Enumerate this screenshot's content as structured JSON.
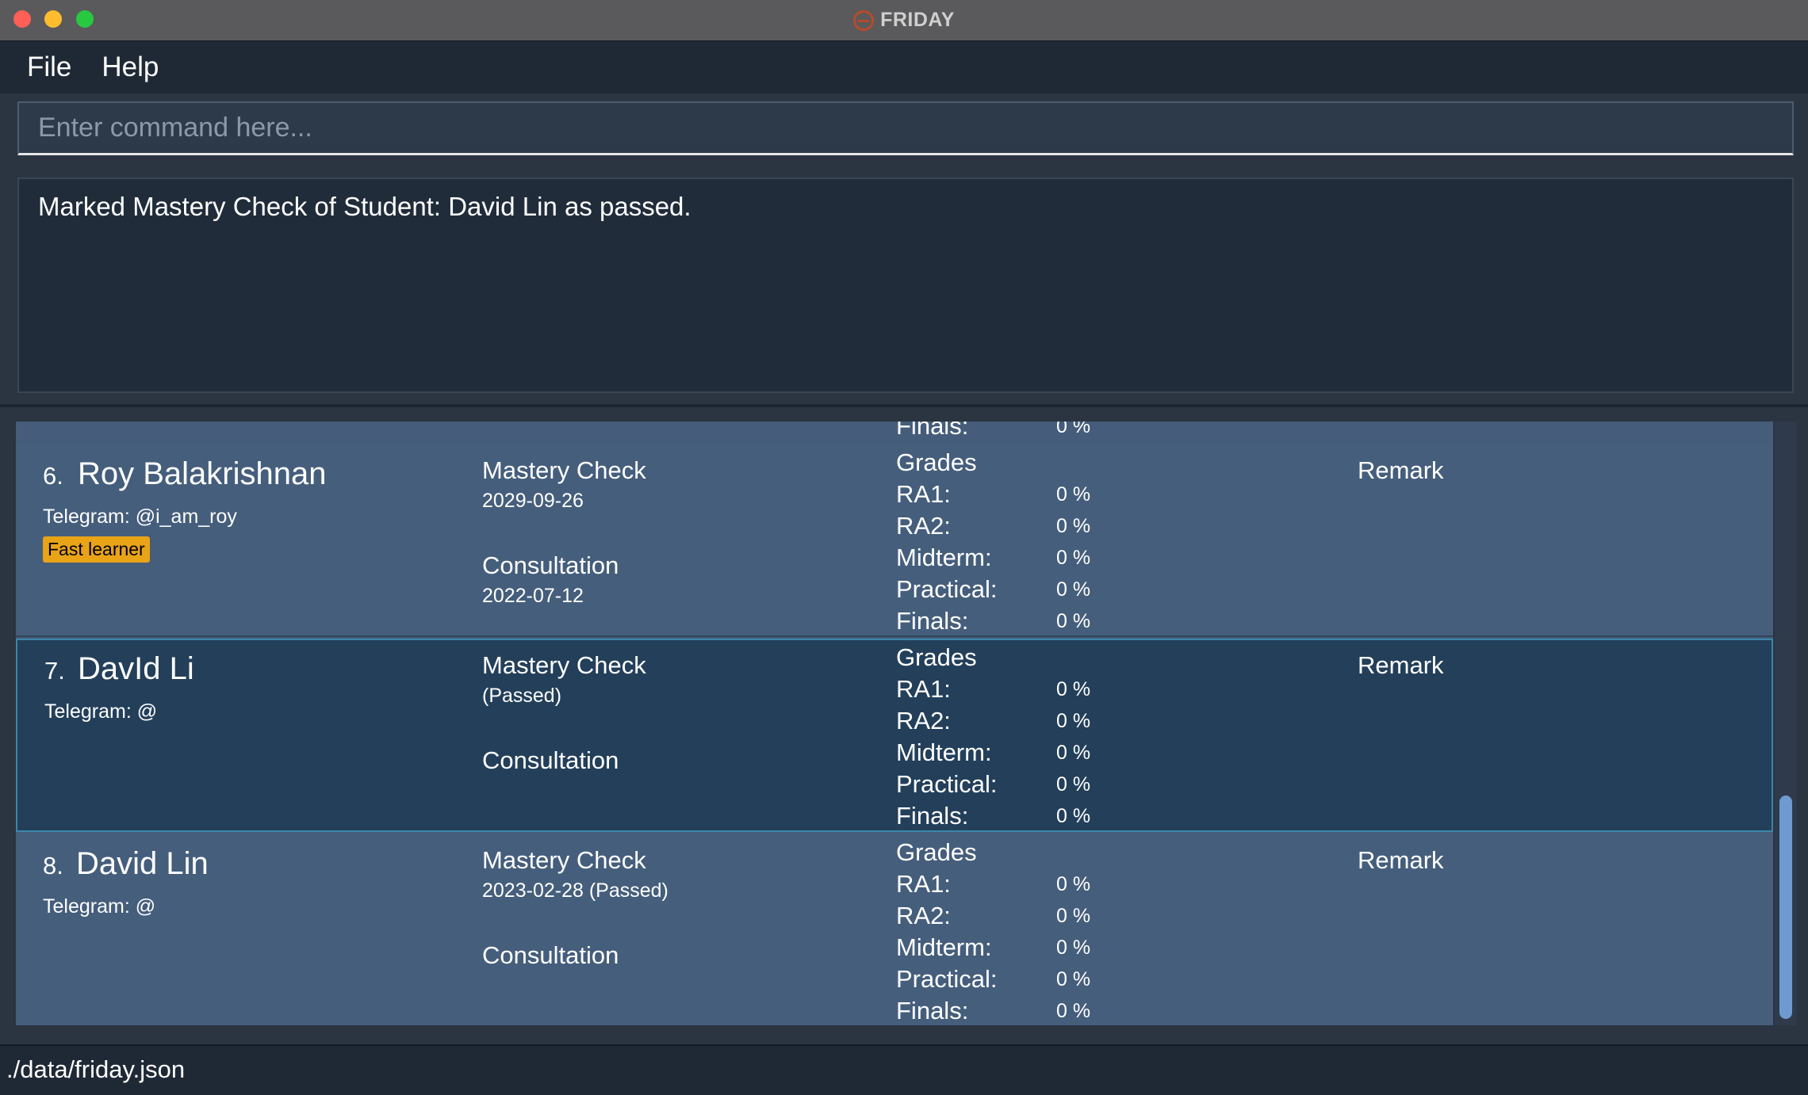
{
  "window": {
    "title": "FRIDAY"
  },
  "menu": {
    "file": "File",
    "help": "Help"
  },
  "command": {
    "placeholder": "Enter command here...",
    "value": ""
  },
  "result": {
    "message": "Marked Mastery Check of Student: David Lin as passed."
  },
  "grade_labels": {
    "header": "Grades",
    "ra1": "RA1:",
    "ra2": "RA2:",
    "midterm": "Midterm:",
    "practical": "Practical:",
    "finals": "Finals:"
  },
  "labels": {
    "mastery": "Mastery Check",
    "consultation": "Consultation",
    "remark": "Remark"
  },
  "partial_row": {
    "finals_label": "Finals:",
    "finals_value": "0 %"
  },
  "students": [
    {
      "index": "6.",
      "name": "Roy Balakrishnan",
      "telegram": "Telegram: @i_am_roy",
      "tag": "Fast learner",
      "mastery_sub": "2029-09-26",
      "consultation_sub": "2022-07-12",
      "grades": {
        "ra1": "0 %",
        "ra2": "0 %",
        "midterm": "0 %",
        "practical": "0 %",
        "finals": "0 %"
      }
    },
    {
      "index": "7.",
      "name": "DavId Li",
      "telegram": "Telegram: @",
      "tag": "",
      "mastery_sub": " (Passed)",
      "consultation_sub": "",
      "grades": {
        "ra1": "0 %",
        "ra2": "0 %",
        "midterm": "0 %",
        "practical": "0 %",
        "finals": "0 %"
      }
    },
    {
      "index": "8.",
      "name": "David Lin",
      "telegram": "Telegram: @",
      "tag": "",
      "mastery_sub": "2023-02-28 (Passed)",
      "consultation_sub": "",
      "grades": {
        "ra1": "0 %",
        "ra2": "0 %",
        "midterm": "0 %",
        "practical": "0 %",
        "finals": "0 %"
      }
    }
  ],
  "status": {
    "path": "./data/friday.json"
  },
  "colors": {
    "tag": "#e8a317",
    "selected_border": "#3d86a8",
    "card": "#455e7c"
  }
}
